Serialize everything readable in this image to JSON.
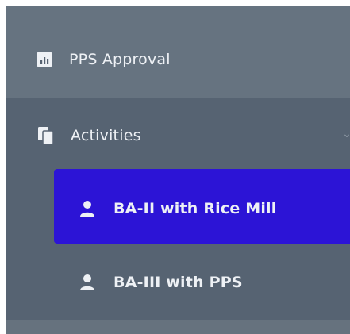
{
  "sidebar": {
    "items": [
      {
        "label": "PPS Approval",
        "icon": "report-icon"
      },
      {
        "label": "Activities",
        "icon": "copy-icon",
        "expanded": true,
        "children": [
          {
            "label": "BA-II with Rice Mill",
            "icon": "user-icon",
            "active": true
          },
          {
            "label": "BA-III with PPS",
            "icon": "user-icon",
            "active": false
          }
        ]
      }
    ]
  },
  "colors": {
    "sidebar_top": "#667380",
    "sidebar_sub": "#566372",
    "active_item": "#2c14d6",
    "text": "#eef1f5"
  }
}
